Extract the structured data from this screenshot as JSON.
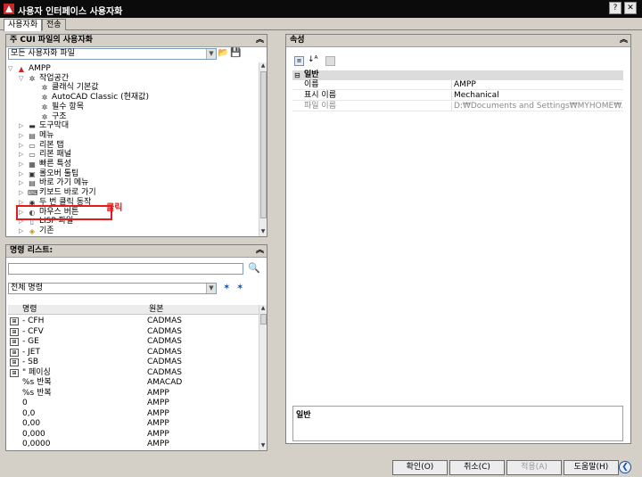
{
  "window": {
    "title": "사용자 인터페이스 사용자화",
    "controls": [
      "?",
      "✕"
    ]
  },
  "tabs": [
    "사용자화",
    "전송"
  ],
  "left_top_panel": {
    "title": "주 CUI 파일의 사용자화",
    "file_combo_value": "모든 사용자화 파일",
    "tree": [
      {
        "label": "AMPP",
        "icon": "ampp-icon",
        "level": 0
      },
      {
        "label": "작업공간",
        "icon": "gear-icon",
        "level": 1
      },
      {
        "label": "클래식 기본값",
        "icon": "gear-icon",
        "level": 2
      },
      {
        "label": "AutoCAD Classic (현재값)",
        "icon": "gear-icon",
        "level": 2
      },
      {
        "label": "필수 항목",
        "icon": "gear-icon",
        "level": 2
      },
      {
        "label": "구조",
        "icon": "gear-icon",
        "level": 2
      },
      {
        "label": "도구막대",
        "icon": "toolbar-icon",
        "level": 1
      },
      {
        "label": "메뉴",
        "icon": "menu-icon",
        "level": 1
      },
      {
        "label": "리본 탭",
        "icon": "ribbon-tab-icon",
        "level": 1
      },
      {
        "label": "리본 패널",
        "icon": "ribbon-panel-icon",
        "level": 1
      },
      {
        "label": "빠른 특성",
        "icon": "quick-properties-icon",
        "level": 1
      },
      {
        "label": "롤오버 툴팁",
        "icon": "rollover-tooltip-icon",
        "level": 1
      },
      {
        "label": "바로 가기 메뉴",
        "icon": "shortcut-menu-icon",
        "level": 1
      },
      {
        "label": "키보드 바로 가기",
        "icon": "keyboard-icon",
        "level": 1
      },
      {
        "label": "두 번 클릭 동작",
        "icon": "double-click-icon",
        "level": 1
      },
      {
        "label": "마우스 버튼",
        "icon": "mouse-icon",
        "level": 1
      },
      {
        "label": "LISP 파일",
        "icon": "lisp-icon",
        "level": 1
      },
      {
        "label": "기존",
        "icon": "legacy-icon",
        "level": 1
      }
    ],
    "annotation": "클릭"
  },
  "left_bottom_panel": {
    "title": "명령 리스트:",
    "search_value": "",
    "filter_combo_value": "전체 명령",
    "columns": [
      "명령",
      "원본"
    ],
    "rows": [
      {
        "cmd": "- CFH",
        "src": "CADMAS",
        "icon": "cfh-icon"
      },
      {
        "cmd": "- CFV",
        "src": "CADMAS",
        "icon": "cfv-icon"
      },
      {
        "cmd": "- GE",
        "src": "CADMAS",
        "icon": "ge-icon"
      },
      {
        "cmd": "- JET",
        "src": "CADMAS",
        "icon": "jet-icon"
      },
      {
        "cmd": "- SB",
        "src": "CADMAS",
        "icon": "sb-icon"
      },
      {
        "cmd": "\"   페이싱",
        "src": "CADMAS",
        "icon": "facing-icon"
      },
      {
        "cmd": "%s 반복",
        "src": "AMACAD",
        "icon": ""
      },
      {
        "cmd": "%s 반복",
        "src": "AMPP",
        "icon": ""
      },
      {
        "cmd": "0",
        "src": "AMPP",
        "icon": ""
      },
      {
        "cmd": "0,0",
        "src": "AMPP",
        "icon": ""
      },
      {
        "cmd": "0,00",
        "src": "AMPP",
        "icon": ""
      },
      {
        "cmd": "0,000",
        "src": "AMPP",
        "icon": ""
      },
      {
        "cmd": "0,0000",
        "src": "AMPP",
        "icon": ""
      }
    ]
  },
  "right_panel": {
    "title": "속성",
    "category": "일반",
    "properties": [
      {
        "name": "이름",
        "value": "AMPP",
        "disabled": false
      },
      {
        "name": "표시 이름",
        "value": "Mechanical",
        "disabled": false
      },
      {
        "name": "파일 이름",
        "value": "D:₩Documents and Settings₩MYHOME₩Applicati",
        "disabled": true
      }
    ],
    "description_title": "일반"
  },
  "buttons": {
    "ok": "확인(O)",
    "cancel": "취소(C)",
    "apply": "적용(A)",
    "help": "도움말(H)"
  },
  "colors": {
    "annotation": "#e41b1b",
    "titlebar": "#0b0b0b"
  }
}
